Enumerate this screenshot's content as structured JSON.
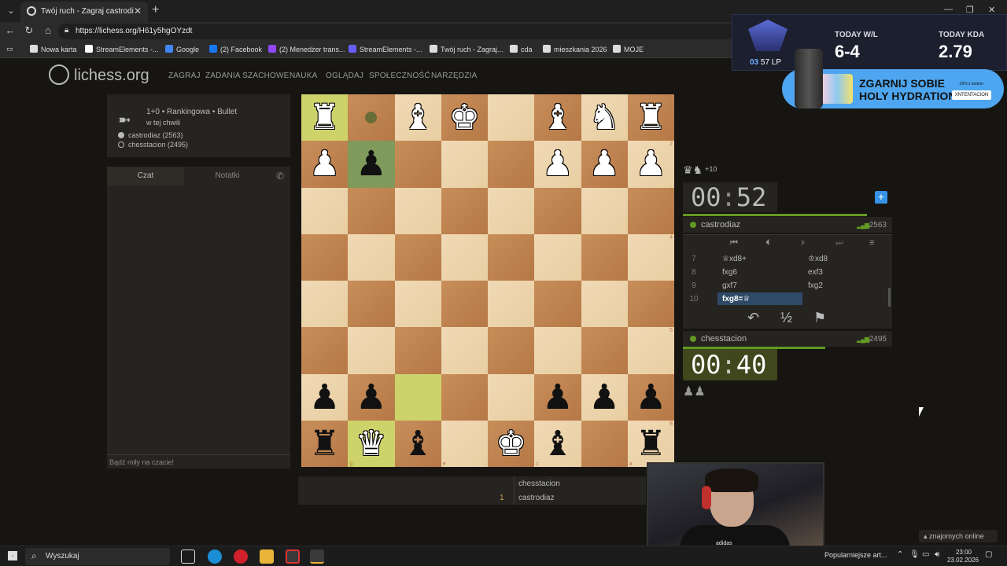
{
  "browser": {
    "tab_title": "Twój ruch - Zagraj castrodiaz • lich",
    "url": "https://lichess.org/H61y5hgOYzdt",
    "bookmarks": [
      {
        "label": "Nowa karta",
        "color": "#dddddd"
      },
      {
        "label": "StreamElements -...",
        "color": "#ffffff"
      },
      {
        "label": "Google",
        "color": "#4285f4"
      },
      {
        "label": "(2) Facebook",
        "color": "#1877f2"
      },
      {
        "label": "(2) Menedżer trans...",
        "color": "#9146ff"
      },
      {
        "label": "StreamElements -...",
        "color": "#6a5cff"
      },
      {
        "label": "Twój ruch - Zagraj...",
        "color": "#dddddd"
      },
      {
        "label": "cda",
        "color": "#dddddd"
      },
      {
        "label": "mieszkania 2026",
        "color": "#dddddd"
      },
      {
        "label": "MOJE",
        "color": "#dddddd"
      }
    ]
  },
  "site": {
    "logo": "lichess.org",
    "nav": [
      "ZAGRAJ",
      "ZADANIA SZACHOWE",
      "NAUKA",
      "OGLĄDAJ",
      "SPOŁECZNOŚĆ",
      "NARZĘDZIA"
    ]
  },
  "game": {
    "setup": "1+0 • Rankingowa • Bullet",
    "time": "w tej chwili",
    "players": [
      {
        "label": "castrodiaz (2563)",
        "color": "#bababa"
      },
      {
        "label": "chesstacion (2495)",
        "color": "#262421"
      }
    ]
  },
  "chat": {
    "tab_chat": "Czat",
    "tab_notes": "Notatki",
    "placeholder": "Bądź miły na czacie!"
  },
  "board": {
    "ranks": [
      "1",
      "2",
      "3",
      "4",
      "5",
      "6",
      "7",
      "8"
    ],
    "files": [
      "h",
      "g",
      "f",
      "e",
      "d",
      "c",
      "b",
      "a"
    ],
    "squares": [
      [
        "wR",
        "dot",
        "wB",
        "wK",
        "",
        "wB",
        "wN",
        "wR"
      ],
      [
        "wP",
        "bP",
        "",
        "",
        "",
        "wP",
        "wP",
        "wP"
      ],
      [
        "",
        "",
        "",
        "",
        "",
        "",
        "",
        ""
      ],
      [
        "",
        "",
        "",
        "",
        "",
        "",
        "",
        ""
      ],
      [
        "",
        "",
        "",
        "",
        "",
        "",
        "",
        ""
      ],
      [
        "",
        "",
        "",
        "",
        "",
        "",
        "",
        ""
      ],
      [
        "bP",
        "bP",
        "",
        "",
        "",
        "bP",
        "bP",
        "bP"
      ],
      [
        "bR",
        "wQ",
        "bB",
        "",
        "wK",
        "bB",
        "",
        "bR"
      ]
    ]
  },
  "opponent": {
    "material": "♛♞",
    "material_diff": "+10",
    "clock_min": "00",
    "clock_sec": "52",
    "name": "castrodiaz",
    "rating": "2563"
  },
  "me": {
    "material": "♟♟",
    "clock_min": "00",
    "clock_sec": "40",
    "name": "chesstacion",
    "rating": "2495"
  },
  "moves": [
    {
      "num": "7",
      "white": "♕xd8+",
      "black": "♔xd8"
    },
    {
      "num": "8",
      "white": "fxg6",
      "black": "exf3"
    },
    {
      "num": "9",
      "white": "gxf7",
      "black": "fxg2"
    },
    {
      "num": "10",
      "white": "fxg8=♕",
      "black": ""
    }
  ],
  "game_controls": {
    "takeback": "↶",
    "draw": "½",
    "resign": "⚑"
  },
  "crosstable": {
    "top": "chesstacion",
    "bottom": "castrodiaz",
    "score": "1"
  },
  "stream": {
    "lp_prefix": "03",
    "lp": "57 LP",
    "wl_label": "TODAY W/L",
    "wl": "6-4",
    "kda_label": "TODAY KDA",
    "kda": "2.79",
    "promo_line1": "ZGARNIJ SOBIE",
    "promo_line2": "HOLY HYDRATION",
    "promo_code": "XNTENTACION",
    "promo_small": "-10% z kodem",
    "webcam_brand": "adidas",
    "friends_online": "znajomych online"
  },
  "taskbar": {
    "search_placeholder": "Wyszukaj",
    "tray_text": "Popularniejsze art...",
    "time": "23:00",
    "date": "23.02.2026"
  }
}
